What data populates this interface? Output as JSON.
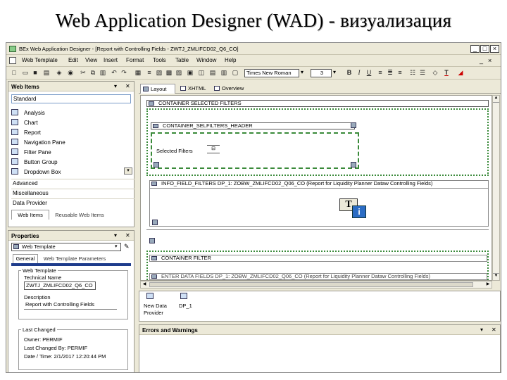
{
  "slide_title": "Web Application Designer (WAD) - визуализация",
  "window": {
    "title": "BEx Web Application Designer - [Report with Controlling Fields - ZWTJ_ZMLIFCD02_Q6_CO]",
    "controls": [
      "_",
      "□",
      "×"
    ]
  },
  "menu": [
    "Web Template",
    "Edit",
    "View",
    "Insert",
    "Format",
    "Tools",
    "Table",
    "Window",
    "Help"
  ],
  "font_toolbar": {
    "font_name": "Times New Roman",
    "font_size": "3"
  },
  "web_items": {
    "title": "Web Items",
    "active_group": "Standard",
    "items": [
      "Analysis",
      "Chart",
      "Report",
      "Navigation Pane",
      "Filter Pane",
      "Button Group",
      "Dropdown Box"
    ],
    "groups": [
      "Advanced",
      "Miscellaneous",
      "Data Provider"
    ],
    "tabs": [
      "Web Items",
      "Reusable Web Items"
    ]
  },
  "properties": {
    "title": "Properties",
    "selected": "Web Template",
    "tabs": [
      "General",
      "Web Template Parameters"
    ],
    "web_template_group": "Web Template",
    "technical_name_label": "Technical Name",
    "technical_name": "ZWTJ_ZMLIFCD02_Q6_CO",
    "description_label": "Description",
    "description": "Report with Controlling Fields",
    "last_changed_group": "Last Changed",
    "owner": "Owner: PERMIF",
    "changed_by": "Last Changed By: PERMIF",
    "date_time": "Date / Time: 2/1/2017 12:20:44 PM"
  },
  "editor_tabs": [
    "Layout",
    "XHTML",
    "Overview"
  ],
  "canvas": {
    "container_selected": "CONTAINER SELECTED FILTERS",
    "selfilters_header": "CONTAINER_SELFILTERS_HEADER",
    "selected_filters": "Selected Filters",
    "info_field": "INFO_FIELD_FILTERS  DP_1: ZOBW_ZMLIFCD02_Q06_CO (Report for Liquidity Planner Dataw Controlling Fields)",
    "container_filter": "CONTAINER FILTER",
    "cut_line": "ENTER DATA FIELDS  DP_1: ZOBW_ZMLIFCD02_Q06_CO (Report for Liquidity Planner Dataw Controlling Fields)"
  },
  "data_providers": [
    {
      "label_1": "New Data",
      "label_2": "Provider"
    },
    {
      "label_1": "DP_1",
      "label_2": ""
    }
  ],
  "errors_panel": {
    "title": "Errors and Warnings"
  }
}
